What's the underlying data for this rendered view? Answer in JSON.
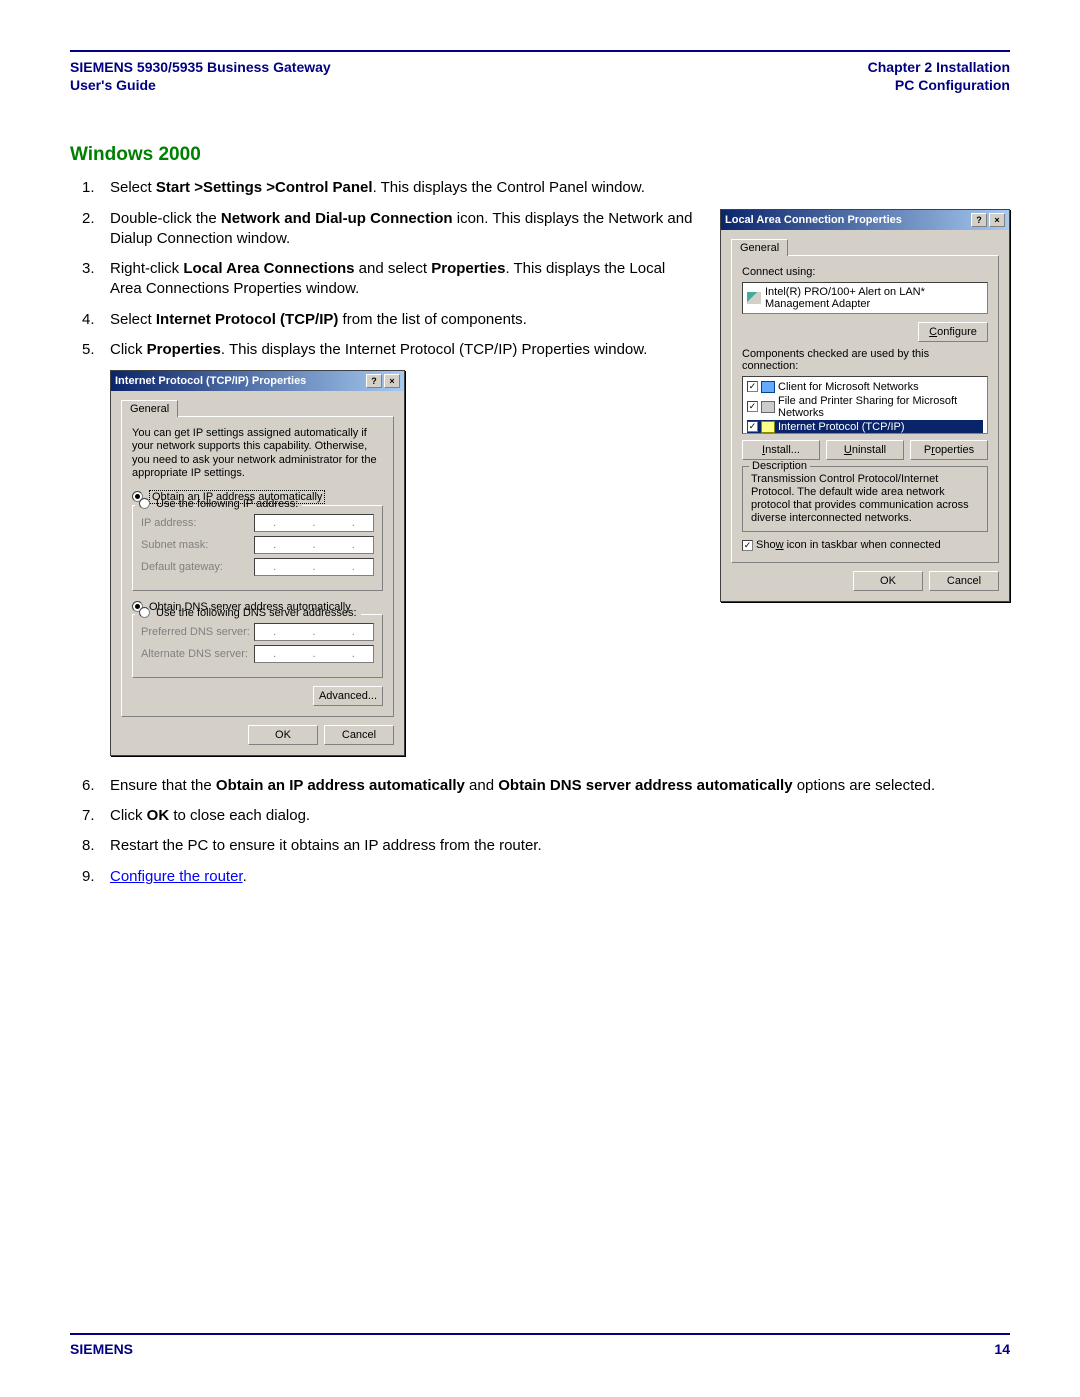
{
  "header": {
    "left1": "SIEMENS 5930/5935 Business Gateway",
    "left2": "User's Guide",
    "right1": "Chapter 2  Installation",
    "right2": "PC Configuration"
  },
  "section_title": "Windows 2000",
  "steps": {
    "s1": {
      "pre": "Select ",
      "b1": "Start >Settings >Control Panel",
      "post": ". This displays the Control Panel window."
    },
    "s2": {
      "pre": "Double-click the ",
      "b1": "Network and Dial-up Connection",
      "post": " icon. This displays the Network and Dialup Connection window."
    },
    "s3": {
      "pre": "Right-click ",
      "b1": "Local Area Connections",
      "mid": " and select ",
      "b2": "Properties",
      "post": ". This displays the Local Area Connections Properties window."
    },
    "s4": {
      "pre": "Select ",
      "b1": "Internet Protocol (TCP/IP)",
      "post": " from the list of components."
    },
    "s5": {
      "pre": " Click ",
      "b1": "Properties",
      "post": ". This displays the Internet Protocol (TCP/IP) Properties window."
    },
    "s6": {
      "pre": "Ensure that the ",
      "b1": "Obtain an IP address automatically",
      "mid": " and ",
      "b2": "Obtain DNS server address automatically",
      "post": " options are selected."
    },
    "s7": {
      "pre": "Click ",
      "b1": "OK",
      "post": " to close each dialog."
    },
    "s8": {
      "text": "Restart the PC to ensure it obtains an IP address from the router."
    },
    "s9": {
      "link": "Configure the router",
      "post": "."
    }
  },
  "tcp_dialog": {
    "title": "Internet Protocol (TCP/IP) Properties",
    "tab": "General",
    "desc": "You can get IP settings assigned automatically if your network supports this capability. Otherwise, you need to ask your network administrator for the appropriate IP settings.",
    "r1": "Obtain an IP address automatically",
    "r2": "Use the following IP address:",
    "ip_addr": "IP address:",
    "subnet": "Subnet mask:",
    "gateway": "Default gateway:",
    "r3": "Obtain DNS server address automatically",
    "r4": "Use the following DNS server addresses:",
    "pref_dns": "Preferred DNS server:",
    "alt_dns": "Alternate DNS server:",
    "advanced": "Advanced...",
    "ok": "OK",
    "cancel": "Cancel"
  },
  "lac_dialog": {
    "title": "Local Area Connection Properties",
    "tab": "General",
    "connect_using": "Connect using:",
    "adapter": "Intel(R) PRO/100+ Alert on LAN* Management Adapter",
    "configure": "Configure",
    "components_label": "Components checked are used by this connection:",
    "items": [
      "Client for Microsoft Networks",
      "File and Printer Sharing for Microsoft Networks",
      "Internet Protocol (TCP/IP)"
    ],
    "install": "Install...",
    "uninstall": "Uninstall",
    "properties": "Properties",
    "desc_label": "Description",
    "desc": "Transmission Control Protocol/Internet Protocol. The default wide area network protocol that provides communication across diverse interconnected networks.",
    "show_icon": "Show icon in taskbar when connected",
    "ok": "OK",
    "cancel": "Cancel"
  },
  "footer": {
    "brand": "SIEMENS",
    "page": "14"
  }
}
